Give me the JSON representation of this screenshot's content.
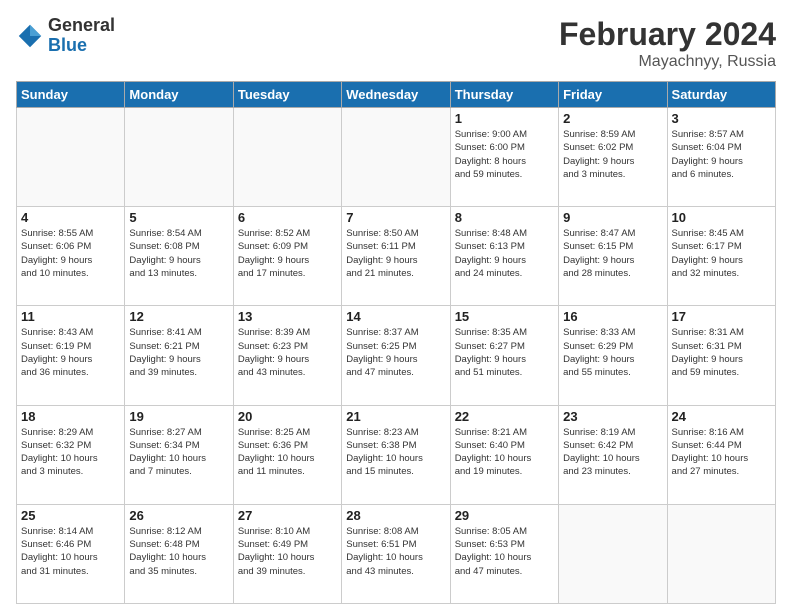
{
  "header": {
    "logo_general": "General",
    "logo_blue": "Blue",
    "month_year": "February 2024",
    "location": "Mayachnyy, Russia"
  },
  "weekdays": [
    "Sunday",
    "Monday",
    "Tuesday",
    "Wednesday",
    "Thursday",
    "Friday",
    "Saturday"
  ],
  "weeks": [
    [
      {
        "day": "",
        "info": ""
      },
      {
        "day": "",
        "info": ""
      },
      {
        "day": "",
        "info": ""
      },
      {
        "day": "",
        "info": ""
      },
      {
        "day": "1",
        "info": "Sunrise: 9:00 AM\nSunset: 6:00 PM\nDaylight: 8 hours\nand 59 minutes."
      },
      {
        "day": "2",
        "info": "Sunrise: 8:59 AM\nSunset: 6:02 PM\nDaylight: 9 hours\nand 3 minutes."
      },
      {
        "day": "3",
        "info": "Sunrise: 8:57 AM\nSunset: 6:04 PM\nDaylight: 9 hours\nand 6 minutes."
      }
    ],
    [
      {
        "day": "4",
        "info": "Sunrise: 8:55 AM\nSunset: 6:06 PM\nDaylight: 9 hours\nand 10 minutes."
      },
      {
        "day": "5",
        "info": "Sunrise: 8:54 AM\nSunset: 6:08 PM\nDaylight: 9 hours\nand 13 minutes."
      },
      {
        "day": "6",
        "info": "Sunrise: 8:52 AM\nSunset: 6:09 PM\nDaylight: 9 hours\nand 17 minutes."
      },
      {
        "day": "7",
        "info": "Sunrise: 8:50 AM\nSunset: 6:11 PM\nDaylight: 9 hours\nand 21 minutes."
      },
      {
        "day": "8",
        "info": "Sunrise: 8:48 AM\nSunset: 6:13 PM\nDaylight: 9 hours\nand 24 minutes."
      },
      {
        "day": "9",
        "info": "Sunrise: 8:47 AM\nSunset: 6:15 PM\nDaylight: 9 hours\nand 28 minutes."
      },
      {
        "day": "10",
        "info": "Sunrise: 8:45 AM\nSunset: 6:17 PM\nDaylight: 9 hours\nand 32 minutes."
      }
    ],
    [
      {
        "day": "11",
        "info": "Sunrise: 8:43 AM\nSunset: 6:19 PM\nDaylight: 9 hours\nand 36 minutes."
      },
      {
        "day": "12",
        "info": "Sunrise: 8:41 AM\nSunset: 6:21 PM\nDaylight: 9 hours\nand 39 minutes."
      },
      {
        "day": "13",
        "info": "Sunrise: 8:39 AM\nSunset: 6:23 PM\nDaylight: 9 hours\nand 43 minutes."
      },
      {
        "day": "14",
        "info": "Sunrise: 8:37 AM\nSunset: 6:25 PM\nDaylight: 9 hours\nand 47 minutes."
      },
      {
        "day": "15",
        "info": "Sunrise: 8:35 AM\nSunset: 6:27 PM\nDaylight: 9 hours\nand 51 minutes."
      },
      {
        "day": "16",
        "info": "Sunrise: 8:33 AM\nSunset: 6:29 PM\nDaylight: 9 hours\nand 55 minutes."
      },
      {
        "day": "17",
        "info": "Sunrise: 8:31 AM\nSunset: 6:31 PM\nDaylight: 9 hours\nand 59 minutes."
      }
    ],
    [
      {
        "day": "18",
        "info": "Sunrise: 8:29 AM\nSunset: 6:32 PM\nDaylight: 10 hours\nand 3 minutes."
      },
      {
        "day": "19",
        "info": "Sunrise: 8:27 AM\nSunset: 6:34 PM\nDaylight: 10 hours\nand 7 minutes."
      },
      {
        "day": "20",
        "info": "Sunrise: 8:25 AM\nSunset: 6:36 PM\nDaylight: 10 hours\nand 11 minutes."
      },
      {
        "day": "21",
        "info": "Sunrise: 8:23 AM\nSunset: 6:38 PM\nDaylight: 10 hours\nand 15 minutes."
      },
      {
        "day": "22",
        "info": "Sunrise: 8:21 AM\nSunset: 6:40 PM\nDaylight: 10 hours\nand 19 minutes."
      },
      {
        "day": "23",
        "info": "Sunrise: 8:19 AM\nSunset: 6:42 PM\nDaylight: 10 hours\nand 23 minutes."
      },
      {
        "day": "24",
        "info": "Sunrise: 8:16 AM\nSunset: 6:44 PM\nDaylight: 10 hours\nand 27 minutes."
      }
    ],
    [
      {
        "day": "25",
        "info": "Sunrise: 8:14 AM\nSunset: 6:46 PM\nDaylight: 10 hours\nand 31 minutes."
      },
      {
        "day": "26",
        "info": "Sunrise: 8:12 AM\nSunset: 6:48 PM\nDaylight: 10 hours\nand 35 minutes."
      },
      {
        "day": "27",
        "info": "Sunrise: 8:10 AM\nSunset: 6:49 PM\nDaylight: 10 hours\nand 39 minutes."
      },
      {
        "day": "28",
        "info": "Sunrise: 8:08 AM\nSunset: 6:51 PM\nDaylight: 10 hours\nand 43 minutes."
      },
      {
        "day": "29",
        "info": "Sunrise: 8:05 AM\nSunset: 6:53 PM\nDaylight: 10 hours\nand 47 minutes."
      },
      {
        "day": "",
        "info": ""
      },
      {
        "day": "",
        "info": ""
      }
    ]
  ]
}
